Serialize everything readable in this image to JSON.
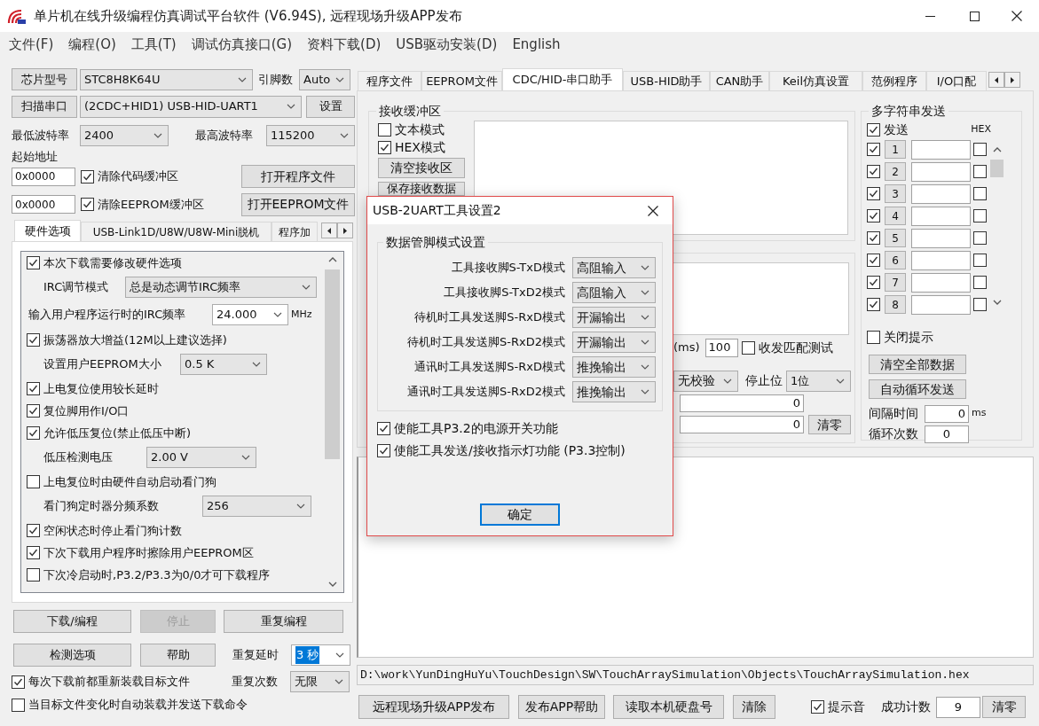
{
  "window": {
    "title": "单片机在线升级编程仿真调试平台软件 (V6.94S), 远程现场升级APP发布"
  },
  "menu": [
    "文件(F)",
    "编程(O)",
    "工具(T)",
    "调试仿真接口(G)",
    "资料下载(D)",
    "USB驱动安装(D)",
    "English"
  ],
  "chip": {
    "button": "芯片型号",
    "value": "STC8H8K64U",
    "pins_label": "引脚数",
    "pins_value": "Auto"
  },
  "port": {
    "button": "扫描串口",
    "value": "(2CDC+HID1) USB-HID-UART1",
    "settings_button": "设置"
  },
  "baud": {
    "min_label": "最低波特率",
    "min_value": "2400",
    "max_label": "最高波特率",
    "max_value": "115200"
  },
  "start_address": {
    "label": "起始地址",
    "rows": [
      {
        "value": "0x0000",
        "checkbox": {
          "label": "清除代码缓冲区",
          "checked": true
        },
        "button": "打开程序文件"
      },
      {
        "value": "0x0000",
        "checkbox": {
          "label": "清除EEPROM缓冲区",
          "checked": true
        },
        "button": "打开EEPROM文件"
      }
    ]
  },
  "left_tabs": [
    {
      "label": "硬件选项",
      "selected": true
    },
    {
      "label": "USB-Link1D/U8W/U8W-Mini脱机",
      "selected": false
    },
    {
      "label": "程序加",
      "selected": false
    }
  ],
  "hardware_options": [
    {
      "kind": "checkbox",
      "label": "本次下载需要修改硬件选项",
      "checked": true
    },
    {
      "kind": "select",
      "label": "IRC调节模式",
      "value": "总是动态调节IRC频率"
    },
    {
      "kind": "combo",
      "label": "输入用户程序运行时的IRC频率",
      "value": "24.000",
      "unit": "MHz"
    },
    {
      "kind": "checkbox",
      "label": "振荡器放大增益(12M以上建议选择)",
      "checked": true
    },
    {
      "kind": "select",
      "label": "设置用户EEPROM大小",
      "value": "0.5 K"
    },
    {
      "kind": "checkbox",
      "label": "上电复位使用较长延时",
      "checked": true
    },
    {
      "kind": "checkbox",
      "label": "复位脚用作I/O口",
      "checked": true
    },
    {
      "kind": "checkbox",
      "label": "允许低压复位(禁止低压中断)",
      "checked": true
    },
    {
      "kind": "select",
      "label": "低压检测电压",
      "value": "2.00 V"
    },
    {
      "kind": "checkbox",
      "label": "上电复位时由硬件自动启动看门狗",
      "checked": false
    },
    {
      "kind": "select",
      "label": "看门狗定时器分频系数",
      "value": "256"
    },
    {
      "kind": "checkbox",
      "label": "空闲状态时停止看门狗计数",
      "checked": true
    },
    {
      "kind": "checkbox",
      "label": "下次下载用户程序时擦除用户EEPROM区",
      "checked": true
    },
    {
      "kind": "checkbox",
      "label": "下次冷启动时,P3.2/P3.3为0/0才可下载程序",
      "checked": false
    }
  ],
  "actions": {
    "buttons": [
      {
        "label": "下载/编程",
        "disabled": false
      },
      {
        "label": "停止",
        "disabled": true
      },
      {
        "label": "重复编程",
        "disabled": false
      },
      {
        "label": "检测选项",
        "disabled": false
      },
      {
        "label": "帮助",
        "disabled": false
      }
    ],
    "repeat_delay": {
      "label": "重复延时",
      "value": "3 秒",
      "text_selected": true
    },
    "repeat_count": {
      "label": "重复次数",
      "value": "无限"
    }
  },
  "reload_options": [
    {
      "label": "每次下载前都重新装载目标文件",
      "checked": true
    },
    {
      "label": "当目标文件变化时自动装载并发送下载命令",
      "checked": false
    }
  ],
  "right_tabs": [
    {
      "label": "程序文件",
      "selected": false
    },
    {
      "label": "EEPROM文件",
      "selected": false
    },
    {
      "label": "CDC/HID-串口助手",
      "selected": true
    },
    {
      "label": "USB-HID助手",
      "selected": false
    },
    {
      "label": "CAN助手",
      "selected": false
    },
    {
      "label": "Keil仿真设置",
      "selected": false
    },
    {
      "label": "范例程序",
      "selected": false
    },
    {
      "label": "I/O口配",
      "selected": false
    }
  ],
  "receive": {
    "title": "接收缓冲区",
    "modes": [
      {
        "label": "文本模式",
        "checked": false
      },
      {
        "label": "HEX模式",
        "checked": true
      }
    ],
    "buttons": [
      "清空接收区",
      "保存接收数据"
    ]
  },
  "send": {
    "period_unit": "(ms)",
    "period_value": "100",
    "match_test": {
      "label": "收发匹配测试",
      "checked": false
    },
    "parity": "无校验",
    "stop_label": "停止位",
    "stop_value": "1位",
    "counters": [
      "0",
      "0"
    ],
    "clear_button": "清零"
  },
  "multi_send": {
    "title": "多字符串发送",
    "send_all": {
      "label": "发送",
      "checked": true
    },
    "hex_label": "HEX",
    "rows": [
      {
        "checked": true,
        "number": "1",
        "hex": false
      },
      {
        "checked": true,
        "number": "2",
        "hex": false
      },
      {
        "checked": true,
        "number": "3",
        "hex": false
      },
      {
        "checked": true,
        "number": "4",
        "hex": false
      },
      {
        "checked": true,
        "number": "5",
        "hex": false
      },
      {
        "checked": true,
        "number": "6",
        "hex": false
      },
      {
        "checked": true,
        "number": "7",
        "hex": false
      },
      {
        "checked": true,
        "number": "8",
        "hex": false
      }
    ],
    "close_hint": {
      "label": "关闭提示",
      "checked": false
    },
    "buttons": [
      "清空全部数据",
      "自动循环发送"
    ],
    "interval_label": "间隔时间",
    "interval_value": "0",
    "interval_unit": "ms",
    "loop_label": "循环次数",
    "loop_value": "0"
  },
  "file_path": "D:\\work\\YunDingHuYu\\TouchDesign\\SW\\TouchArraySimulation\\Objects\\TouchArraySimulation.hex",
  "bottom": {
    "buttons": [
      "远程现场升级APP发布",
      "发布APP帮助",
      "读取本机硬盘号",
      "清除"
    ],
    "beep": {
      "label": "提示音",
      "checked": true
    },
    "count_label": "成功计数",
    "count_value": "9",
    "clear_button": "清零"
  },
  "dialog": {
    "title": "USB-2UART工具设置2",
    "group_title": "数据管脚模式设置",
    "pins": [
      {
        "label": "工具接收脚S-TxD模式",
        "value": "高阻输入"
      },
      {
        "label": "工具接收脚S-TxD2模式",
        "value": "高阻输入"
      },
      {
        "label": "待机时工具发送脚S-RxD模式",
        "value": "开漏输出"
      },
      {
        "label": "待机时工具发送脚S-RxD2模式",
        "value": "开漏输出"
      },
      {
        "label": "通讯时工具发送脚S-RxD模式",
        "value": "推挽输出"
      },
      {
        "label": "通讯时工具发送脚S-RxD2模式",
        "value": "推挽输出"
      }
    ],
    "options": [
      {
        "label": "使能工具P3.2的电源开关功能",
        "checked": true
      },
      {
        "label": "使能工具发送/接收指示灯功能 (P3.3控制)",
        "checked": true
      }
    ],
    "ok_button": "确定"
  }
}
